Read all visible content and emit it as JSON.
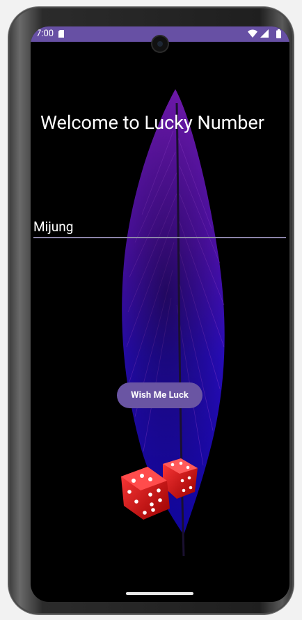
{
  "status_bar": {
    "time": "7:00",
    "color": "#6750a4"
  },
  "app": {
    "title": "Welcome to Lucky Number",
    "name_input_value": "Mijung",
    "button_label": "Wish Me Luck",
    "button_color": "#6a55a3"
  },
  "icons": [
    "sd-card-icon",
    "wifi-icon",
    "signal-icon",
    "battery-icon",
    "feather-image",
    "dice-image"
  ]
}
